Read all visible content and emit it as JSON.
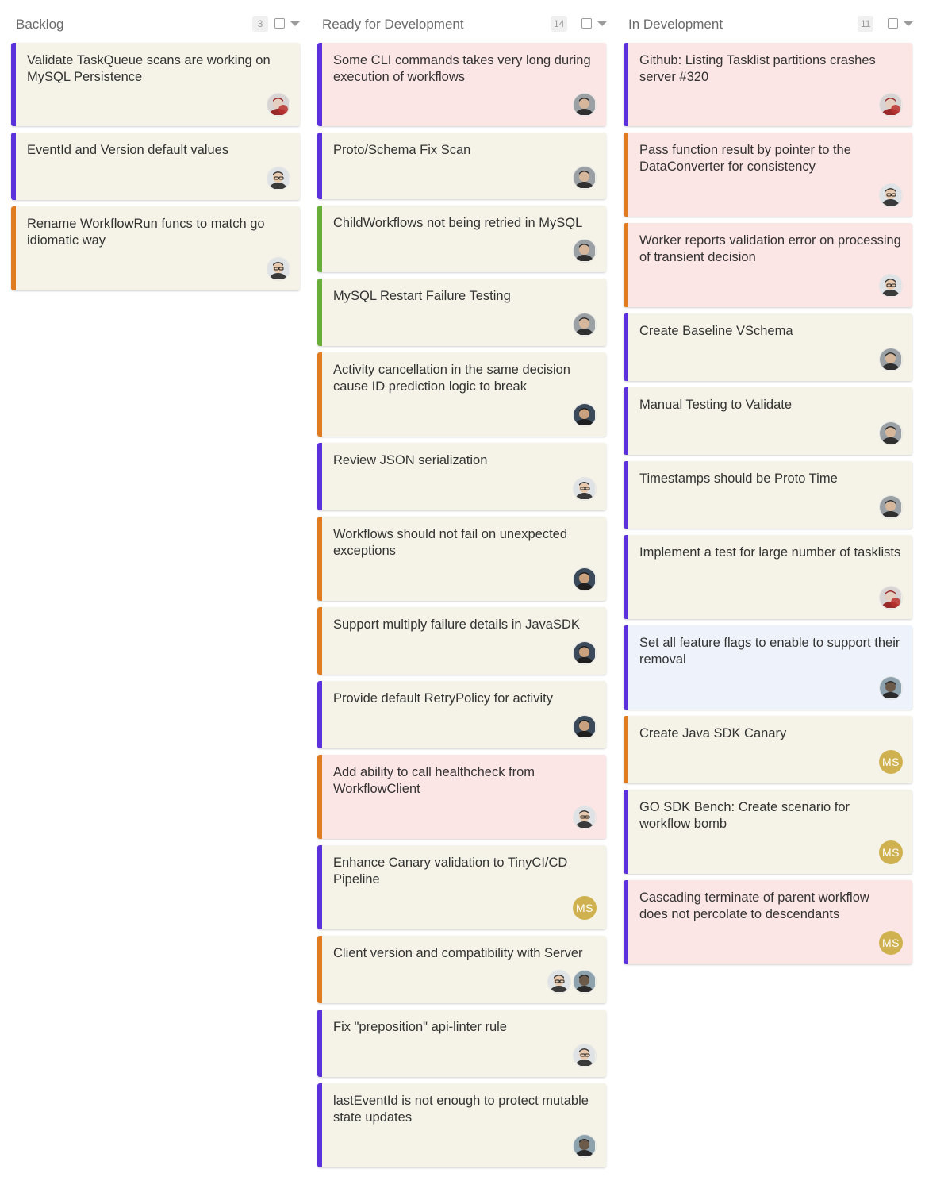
{
  "colors": {
    "purple": "#5b31dc",
    "orange": "#e07b20",
    "green": "#6aae3a",
    "card_default": "#f5f3e7",
    "card_pink": "#fce5e5",
    "card_blue": "#eef3fb",
    "initials_avatar": "#cfb24f"
  },
  "columns": [
    {
      "title": "Backlog",
      "count": "3",
      "cards": [
        {
          "title": "Validate TaskQueue scans are working on MySQL Persistence",
          "label": "purple",
          "bg": "card_default",
          "avatars": [
            "avatar-redblur-icon"
          ]
        },
        {
          "title": "EventId and Version default values",
          "label": "purple",
          "bg": "card_default",
          "avatars": [
            "avatar-glasses-icon"
          ]
        },
        {
          "title": "Rename WorkflowRun funcs to match go idiomatic way",
          "label": "orange",
          "bg": "card_default",
          "avatars": [
            "avatar-glasses-icon"
          ]
        }
      ]
    },
    {
      "title": "Ready for Development",
      "count": "14",
      "cards": [
        {
          "title": "Some CLI commands takes very long during execution of workflows",
          "label": "purple",
          "bg": "card_pink",
          "avatars": [
            "avatar-grey-man-icon"
          ]
        },
        {
          "title": "Proto/Schema Fix Scan",
          "label": "purple",
          "bg": "card_default",
          "avatars": [
            "avatar-grey-man-icon"
          ]
        },
        {
          "title": "ChildWorkflows not being retried in MySQL",
          "label": "green",
          "bg": "card_default",
          "avatars": [
            "avatar-grey-man-icon"
          ]
        },
        {
          "title": "MySQL Restart Failure Testing",
          "label": "green",
          "bg": "card_default",
          "avatars": [
            "avatar-grey-man-icon"
          ]
        },
        {
          "title": "Activity cancellation in the same decision cause ID prediction logic to break",
          "label": "orange",
          "bg": "card_default",
          "avatars": [
            "avatar-dark-man-icon"
          ]
        },
        {
          "title": "Review JSON serialization",
          "label": "purple",
          "bg": "card_default",
          "avatars": [
            "avatar-glasses-icon"
          ]
        },
        {
          "title": "Workflows should not fail on unexpected exceptions",
          "label": "orange",
          "bg": "card_default",
          "avatars": [
            "avatar-dark-man-icon"
          ]
        },
        {
          "title": "Support multiply failure details in JavaSDK",
          "label": "orange",
          "bg": "card_default",
          "avatars": [
            "avatar-dark-man-icon"
          ]
        },
        {
          "title": "Provide default RetryPolicy for activity",
          "label": "purple",
          "bg": "card_default",
          "avatars": [
            "avatar-dark-man-icon"
          ]
        },
        {
          "title": "Add ability to call healthcheck from WorkflowClient",
          "label": "orange",
          "bg": "card_pink",
          "avatars": [
            "avatar-glasses-icon"
          ]
        },
        {
          "title": "Enhance Canary validation to TinyCI/CD Pipeline",
          "label": "purple",
          "bg": "card_default",
          "avatars": [
            "MS"
          ]
        },
        {
          "title": "Client version and compatibility with Server",
          "label": "orange",
          "bg": "card_default",
          "avatars": [
            "avatar-glasses-icon",
            "avatar-outdoor-icon"
          ]
        },
        {
          "title": "Fix \"preposition\" api-linter rule",
          "label": "purple",
          "bg": "card_default",
          "avatars": [
            "avatar-glasses-icon"
          ]
        },
        {
          "title": "lastEventId is not enough to protect mutable state updates",
          "label": "purple",
          "bg": "card_default",
          "avatars": [
            "avatar-outdoor-icon"
          ]
        }
      ]
    },
    {
      "title": "In Development",
      "count": "11",
      "cards": [
        {
          "title": "Github: Listing Tasklist partitions crashes server #320",
          "label": "purple",
          "bg": "card_pink",
          "avatars": [
            "avatar-redblur-icon"
          ]
        },
        {
          "title": "Pass function result by pointer to the DataConverter for consistency",
          "label": "orange",
          "bg": "card_pink",
          "avatars": [
            "avatar-glasses-icon"
          ]
        },
        {
          "title": "Worker reports validation error on processing of transient decision",
          "label": "orange",
          "bg": "card_pink",
          "avatars": [
            "avatar-glasses-icon"
          ]
        },
        {
          "title": "Create Baseline VSchema",
          "label": "purple",
          "bg": "card_default",
          "avatars": [
            "avatar-grey-man-icon"
          ]
        },
        {
          "title": "Manual Testing to Validate",
          "label": "purple",
          "bg": "card_default",
          "avatars": [
            "avatar-grey-man-icon"
          ]
        },
        {
          "title": "Timestamps should be Proto Time",
          "label": "purple",
          "bg": "card_default",
          "avatars": [
            "avatar-grey-man-icon"
          ]
        },
        {
          "title": "Implement a test for large number of tasklists",
          "label": "purple",
          "bg": "card_default",
          "avatars": [
            "avatar-redblur-icon"
          ]
        },
        {
          "title": "Set all feature flags to enable to support their removal",
          "label": "purple",
          "bg": "card_blue",
          "avatars": [
            "avatar-outdoor-icon"
          ]
        },
        {
          "title": "Create Java SDK Canary",
          "label": "orange",
          "bg": "card_default",
          "avatars": [
            "MS"
          ]
        },
        {
          "title": "GO SDK Bench: Create scenario for workflow bomb",
          "label": "purple",
          "bg": "card_default",
          "avatars": [
            "MS"
          ]
        },
        {
          "title": "Cascading terminate of parent workflow does not percolate to descendants",
          "label": "purple",
          "bg": "card_pink",
          "avatars": [
            "MS"
          ]
        }
      ]
    }
  ]
}
